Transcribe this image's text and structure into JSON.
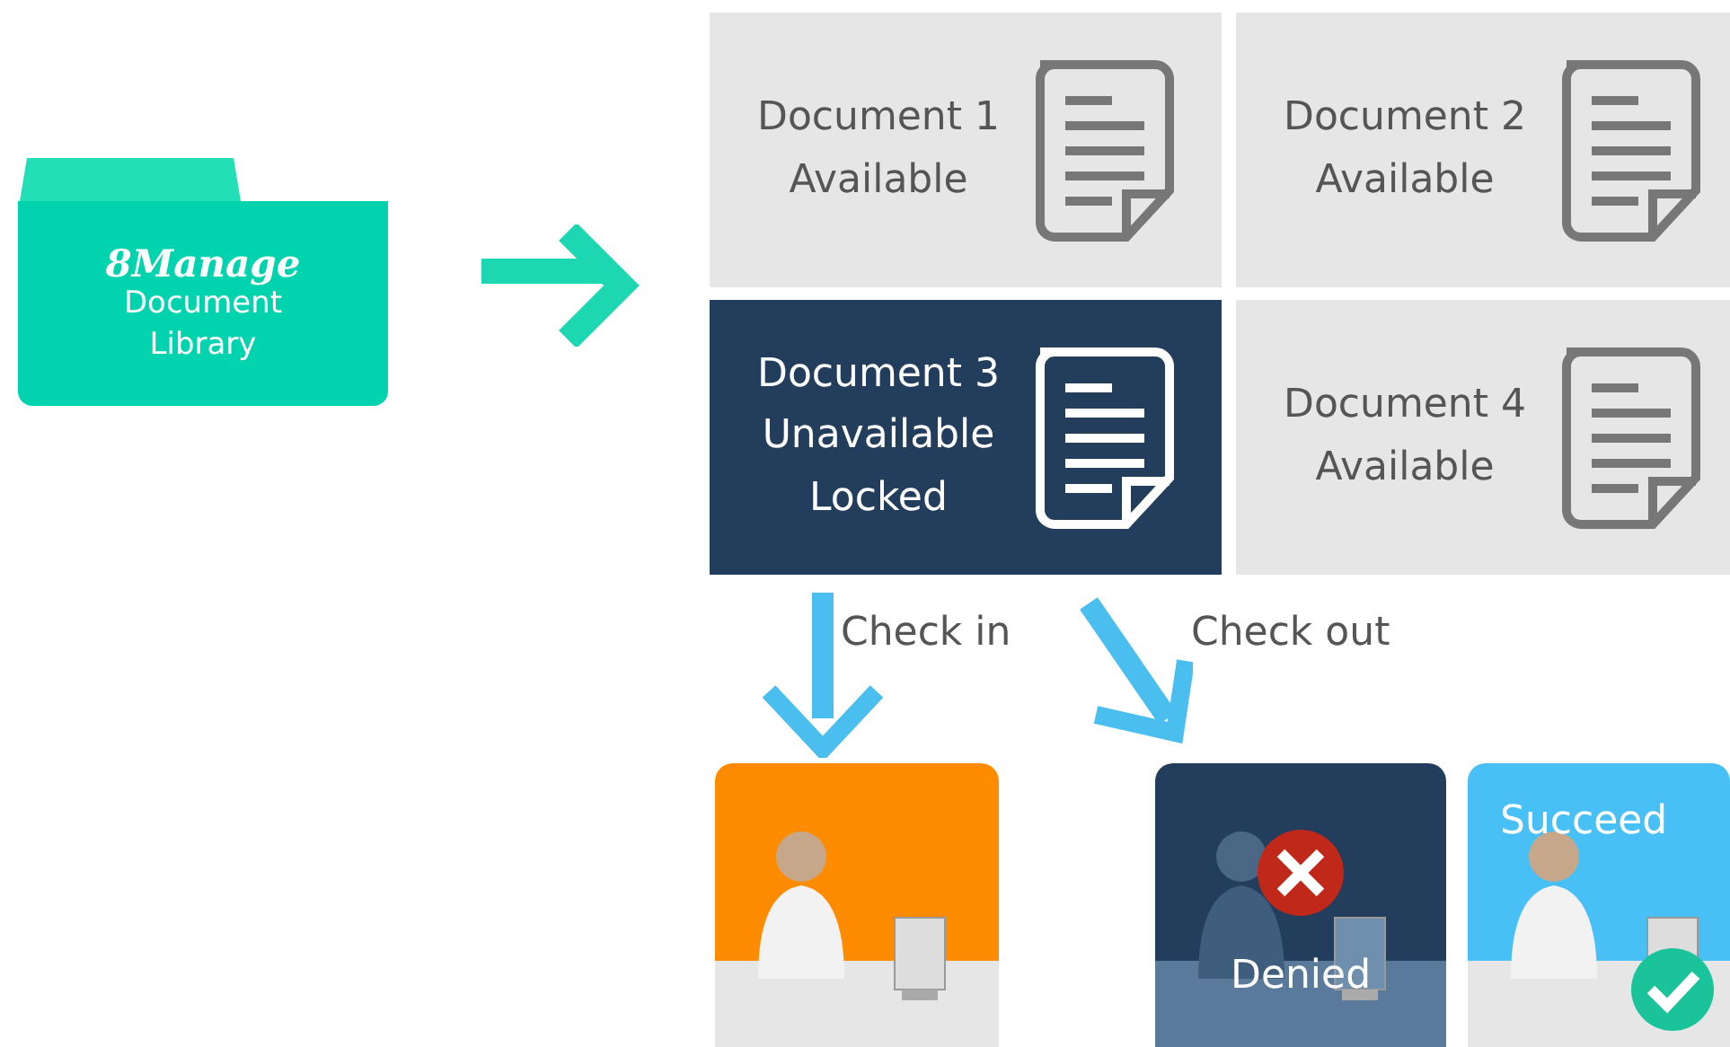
{
  "library": {
    "logo": "8Manage",
    "label": "Document Library"
  },
  "documents": [
    {
      "lines": [
        "Document 1",
        "Available"
      ],
      "locked": false
    },
    {
      "lines": [
        "Document 2",
        "Available"
      ],
      "locked": false
    },
    {
      "lines": [
        "Document 3",
        "Unavailable",
        "Locked"
      ],
      "locked": true
    },
    {
      "lines": [
        "Document 4",
        "Available"
      ],
      "locked": false
    }
  ],
  "actions": [
    "Check in",
    "Check out"
  ],
  "scenes": [
    {
      "kind": "working"
    },
    {
      "kind": "denied",
      "caption": "Denied"
    },
    {
      "kind": "succeed",
      "caption": "Succeed"
    }
  ]
}
